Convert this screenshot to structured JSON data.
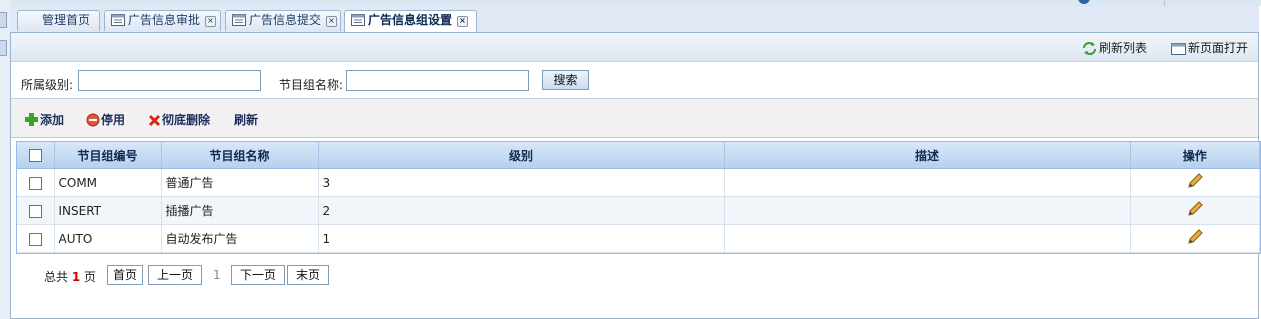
{
  "tabs": [
    {
      "label": "管理首页",
      "active": false,
      "closable": false
    },
    {
      "label": "广告信息审批",
      "active": false,
      "closable": true
    },
    {
      "label": "广告信息提交",
      "active": false,
      "closable": true
    },
    {
      "label": "广告信息组设置",
      "active": true,
      "closable": true
    }
  ],
  "toolbar": {
    "refresh_list": "刷新列表",
    "open_new_page": "新页面打开"
  },
  "search": {
    "level_label": "所属级别:",
    "level_value": "",
    "name_label": "节目组名称:",
    "name_value": "",
    "button": "搜索"
  },
  "actions": {
    "add": "添加",
    "disable": "停用",
    "delete": "彻底删除",
    "refresh": "刷新"
  },
  "table": {
    "columns": [
      "节目组编号",
      "节目组名称",
      "级别",
      "描述",
      "操作"
    ],
    "rows": [
      {
        "code": "COMM",
        "name": "普通广告",
        "level": "3",
        "desc": ""
      },
      {
        "code": "INSERT",
        "name": "插播广告",
        "level": "2",
        "desc": ""
      },
      {
        "code": "AUTO",
        "name": "自动发布广告",
        "level": "1",
        "desc": ""
      }
    ]
  },
  "pager": {
    "total_prefix": "总共",
    "total_pages": "1",
    "total_suffix": "页",
    "first": "首页",
    "prev": "上一页",
    "current": "1",
    "next": "下一页",
    "last": "末页"
  },
  "colors": {
    "accent": "#2f5fa5",
    "header_blue": "#b7d0ed",
    "page_count": "#d30000"
  }
}
